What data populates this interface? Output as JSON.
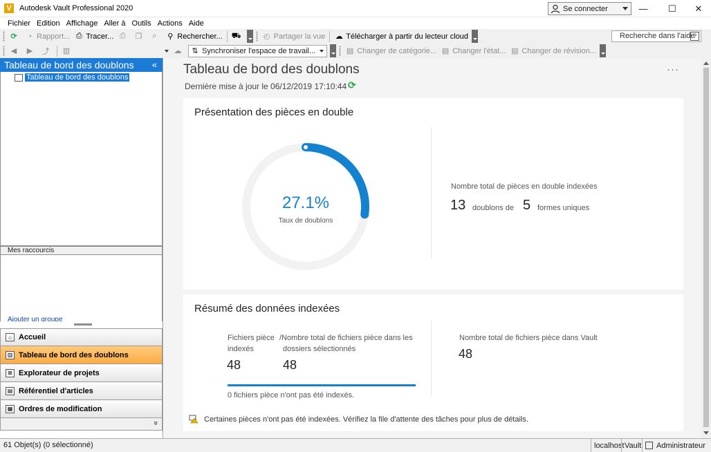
{
  "window": {
    "title": "Autodesk Vault Professional 2020",
    "logo_letter": "V",
    "signin_label": "Se connecter",
    "minimize": "—",
    "maximize": "☐",
    "close": "✕"
  },
  "menu": [
    "Fichier",
    "Edition",
    "Affichage",
    "Aller à",
    "Outils",
    "Actions",
    "Aide"
  ],
  "toolbar1": {
    "report": "Rapport...",
    "trace": "Tracer...",
    "search": "Rechercher...",
    "share_view": "Partager la vue",
    "download_cloud": "Télécharger à partir du lecteur cloud",
    "help_search_placeholder": "Recherche dans l'aide",
    "help_q": "?"
  },
  "toolbar2": {
    "sync": "Synchroniser l'espace de travail...",
    "change_category": "Changer de catégorie...",
    "change_state": "Changer l'état...",
    "change_revision": "Changer de révision..."
  },
  "left_panel": {
    "header": "Tableau de bord des doublons",
    "collapse": "«",
    "tree_item": "Tableau de bord des doublons",
    "shortcuts_header": "Mes raccourcis",
    "add_group": "Ajouter un groupe",
    "nav": [
      {
        "label": "Accueil",
        "active": false
      },
      {
        "label": "Tableau de bord des doublons",
        "active": true
      },
      {
        "label": "Explorateur de projets",
        "active": false
      },
      {
        "label": "Référentiel d'articles",
        "active": false
      },
      {
        "label": "Ordres de modification",
        "active": false
      }
    ]
  },
  "main": {
    "title": "Tableau de bord des doublons",
    "more": "···",
    "last_updated": "Dernière mise à jour le 06/12/2019 17:10:44",
    "refresh_icon": "⟳",
    "overview": {
      "title": "Présentation des pièces en double",
      "percent": "27.1%",
      "percent_value": 27.1,
      "percent_label": "Taux de doublons",
      "total_label": "Nombre total de pièces en double indexées",
      "duplicates_count": "13",
      "duplicates_text": "doublons de",
      "unique_count": "5",
      "unique_text": "formes uniques",
      "accent": "#1582d0",
      "track": "#f2f2f2"
    },
    "summary": {
      "title": "Résumé des données indexées",
      "col1_label_a": "Fichiers pièce",
      "col1_label_b": "indexés",
      "col1_value": "48",
      "col2_label_a": "/Nombre total de fichiers pièce dans les",
      "col2_label_b": "dossiers sélectionnés",
      "col2_value": "48",
      "not_indexed": "0  fichiers pièce n'ont pas été indexés.",
      "vault_label": "Nombre total de fichiers pièce dans Vault",
      "vault_value": "48",
      "warning": "Certaines pièces n'ont pas été indexées. Vérifiez la file d'attente des tâches pour plus de détails."
    }
  },
  "status": {
    "objects": "61 Objet(s) (0 sélectionné)",
    "server": "localhost",
    "vault": "Vault",
    "user": "Administrateur"
  }
}
